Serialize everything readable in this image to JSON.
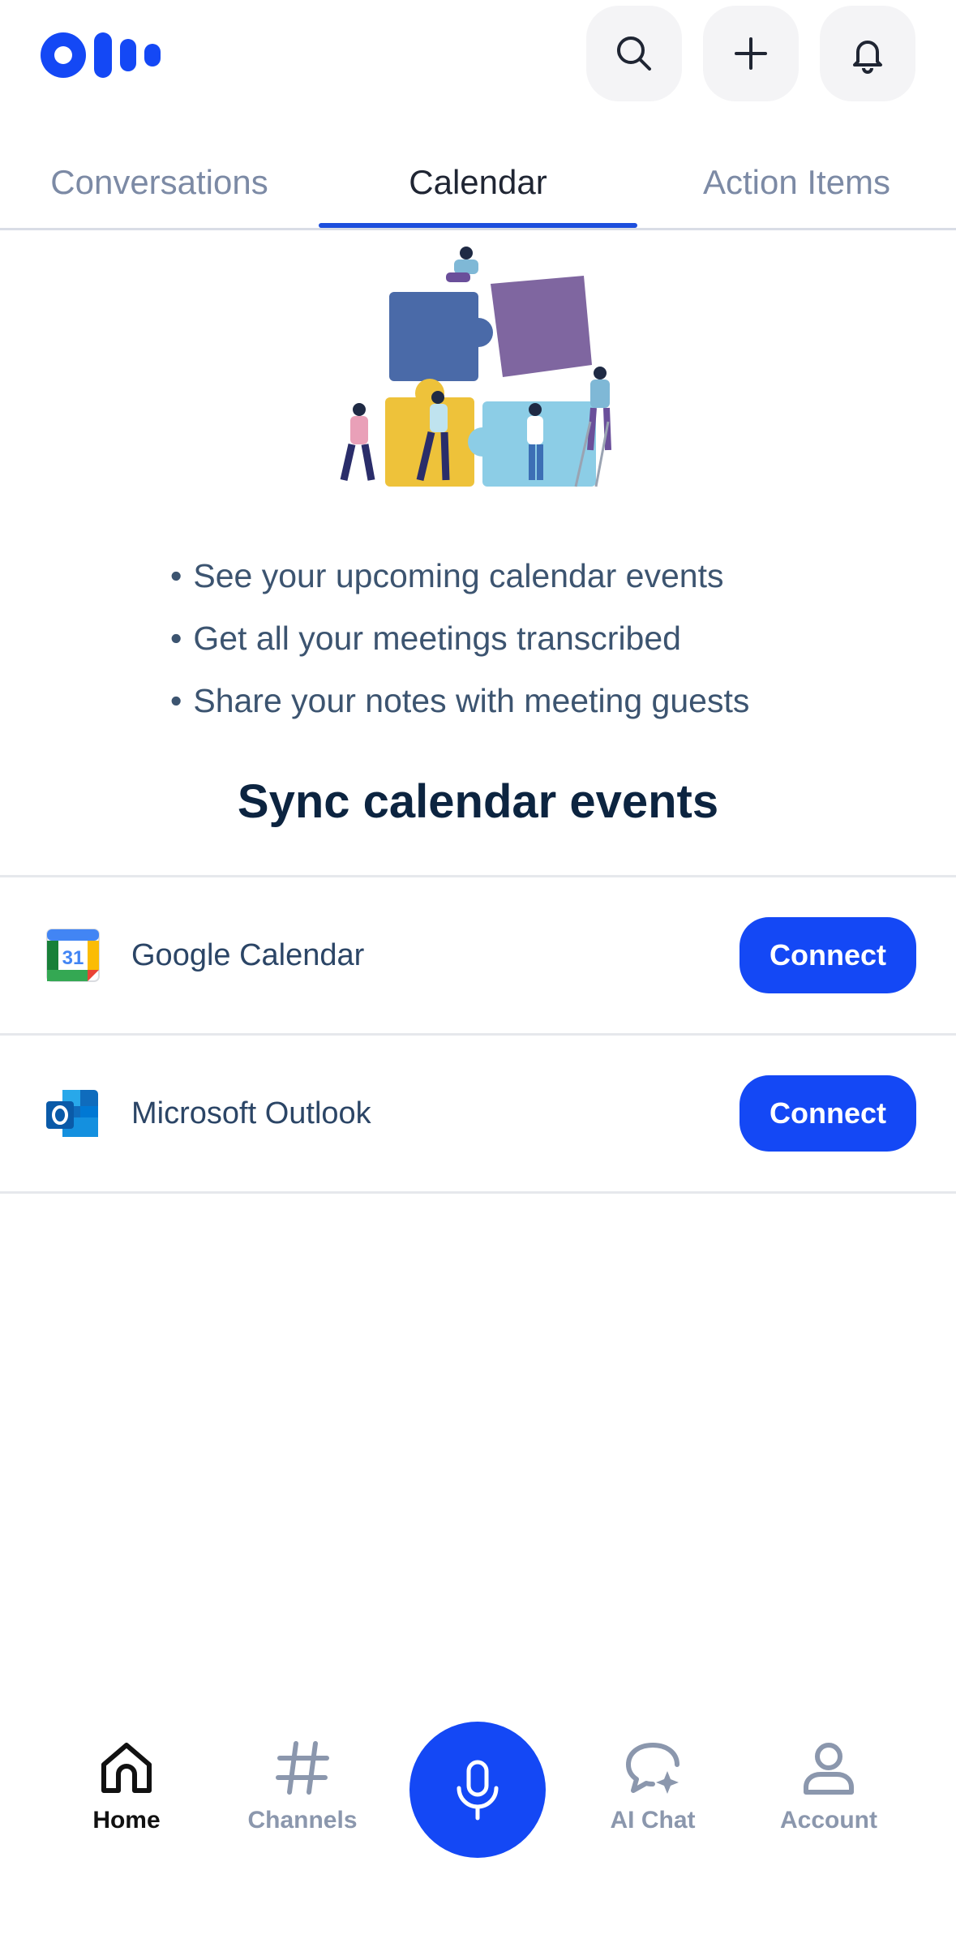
{
  "header": {
    "logo_alt": "Otter",
    "search_icon": "search-icon",
    "add_icon": "plus-icon",
    "notifications_icon": "bell-icon"
  },
  "tabs": [
    {
      "label": "Conversations",
      "active": false
    },
    {
      "label": "Calendar",
      "active": true
    },
    {
      "label": "Action Items",
      "active": false
    }
  ],
  "bullets": [
    "See your upcoming calendar events",
    "Get all your meetings transcribed",
    "Share your notes with meeting guests"
  ],
  "sync": {
    "title": "Sync calendar events",
    "providers": [
      {
        "name": "Google Calendar",
        "icon": "google-calendar-icon",
        "button": "Connect"
      },
      {
        "name": "Microsoft Outlook",
        "icon": "outlook-icon",
        "button": "Connect"
      }
    ]
  },
  "nav": {
    "home": "Home",
    "channels": "Channels",
    "record_icon": "microphone-icon",
    "ai_chat": "AI Chat",
    "account": "Account"
  },
  "colors": {
    "accent": "#1448f5",
    "tab_indicator": "#1d4fdd",
    "text_dark": "#0c2440",
    "text_muted": "#7c8aa5"
  }
}
